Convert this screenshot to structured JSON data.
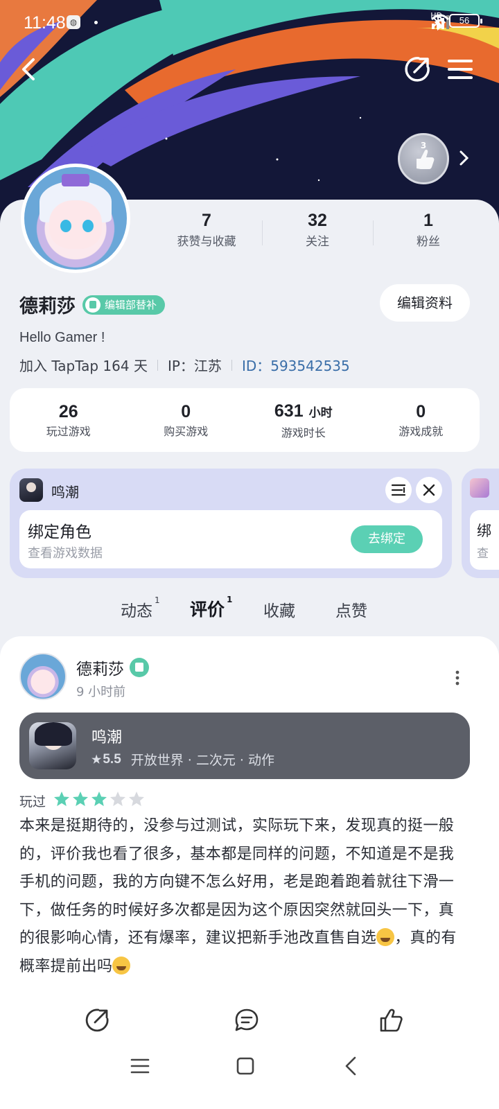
{
  "status_bar": {
    "time": "11:48",
    "network": "HD",
    "battery": "56"
  },
  "header": {
    "medal_count": "3"
  },
  "profile": {
    "name": "德莉莎",
    "role_badge": "编辑部替补",
    "edit_label": "编辑资料",
    "bio": "Hello Gamer !",
    "joined": "加入 TapTap 164 天",
    "ip": "IP：江苏",
    "id": "ID：593542535",
    "top_stats": [
      {
        "value": "7",
        "label": "获赞与收藏"
      },
      {
        "value": "32",
        "label": "关注"
      },
      {
        "value": "1",
        "label": "粉丝"
      }
    ],
    "game_stats": [
      {
        "value": "26",
        "unit": "",
        "label": "玩过游戏"
      },
      {
        "value": "0",
        "unit": "",
        "label": "购买游戏"
      },
      {
        "value": "631",
        "unit": "小时",
        "label": "游戏时长"
      },
      {
        "value": "0",
        "unit": "",
        "label": "游戏成就"
      }
    ]
  },
  "bind_card": {
    "game_name": "鸣潮",
    "title": "绑定角色",
    "subtitle": "查看游戏数据",
    "button": "去绑定",
    "peek_title": "绑",
    "peek_sub": "查"
  },
  "tabs": [
    {
      "label": "动态",
      "count": "1"
    },
    {
      "label": "评价",
      "count": "1",
      "active": true
    },
    {
      "label": "收藏",
      "count": ""
    },
    {
      "label": "点赞",
      "count": ""
    }
  ],
  "post": {
    "author": "德莉莎",
    "time": "9 小时前",
    "game": {
      "name": "鸣潮",
      "score": "5.5",
      "tags": "开放世界 · 二次元 · 动作"
    },
    "rating_label": "玩过",
    "rating": 3,
    "rating_max": 5,
    "text_part1": "本来是挺期待的，没参与过测试，实际玩下来，发现真的挺一般的，评价我也看了很多，基本都是同样的问题，不知道是不是我手机的问题，我的方向键不怎么好用，老是跑着跑着就往下滑一下，做任务的时候好多次都是因为这个原因突然就回头一下，真的很影响心情，还有爆率，建议把新手池改直售自选",
    "text_part2": "，真的有概率提前出吗"
  },
  "colors": {
    "accent": "#5bd0b4",
    "badge_green": "#58c9a8",
    "id_link": "#3a6ea8",
    "banner_bg": "#131738",
    "game_card": "#5c5f68",
    "bind_card": "#d8dbf5"
  },
  "icons": [
    "back-icon",
    "share-icon",
    "menu-icon",
    "thumbs-up-medal-icon",
    "chevron-right-icon",
    "filter-icon",
    "close-icon",
    "star-icon",
    "more-vertical-icon",
    "comment-icon",
    "like-icon",
    "nav-menu-icon",
    "nav-home-icon",
    "nav-back-icon"
  ]
}
